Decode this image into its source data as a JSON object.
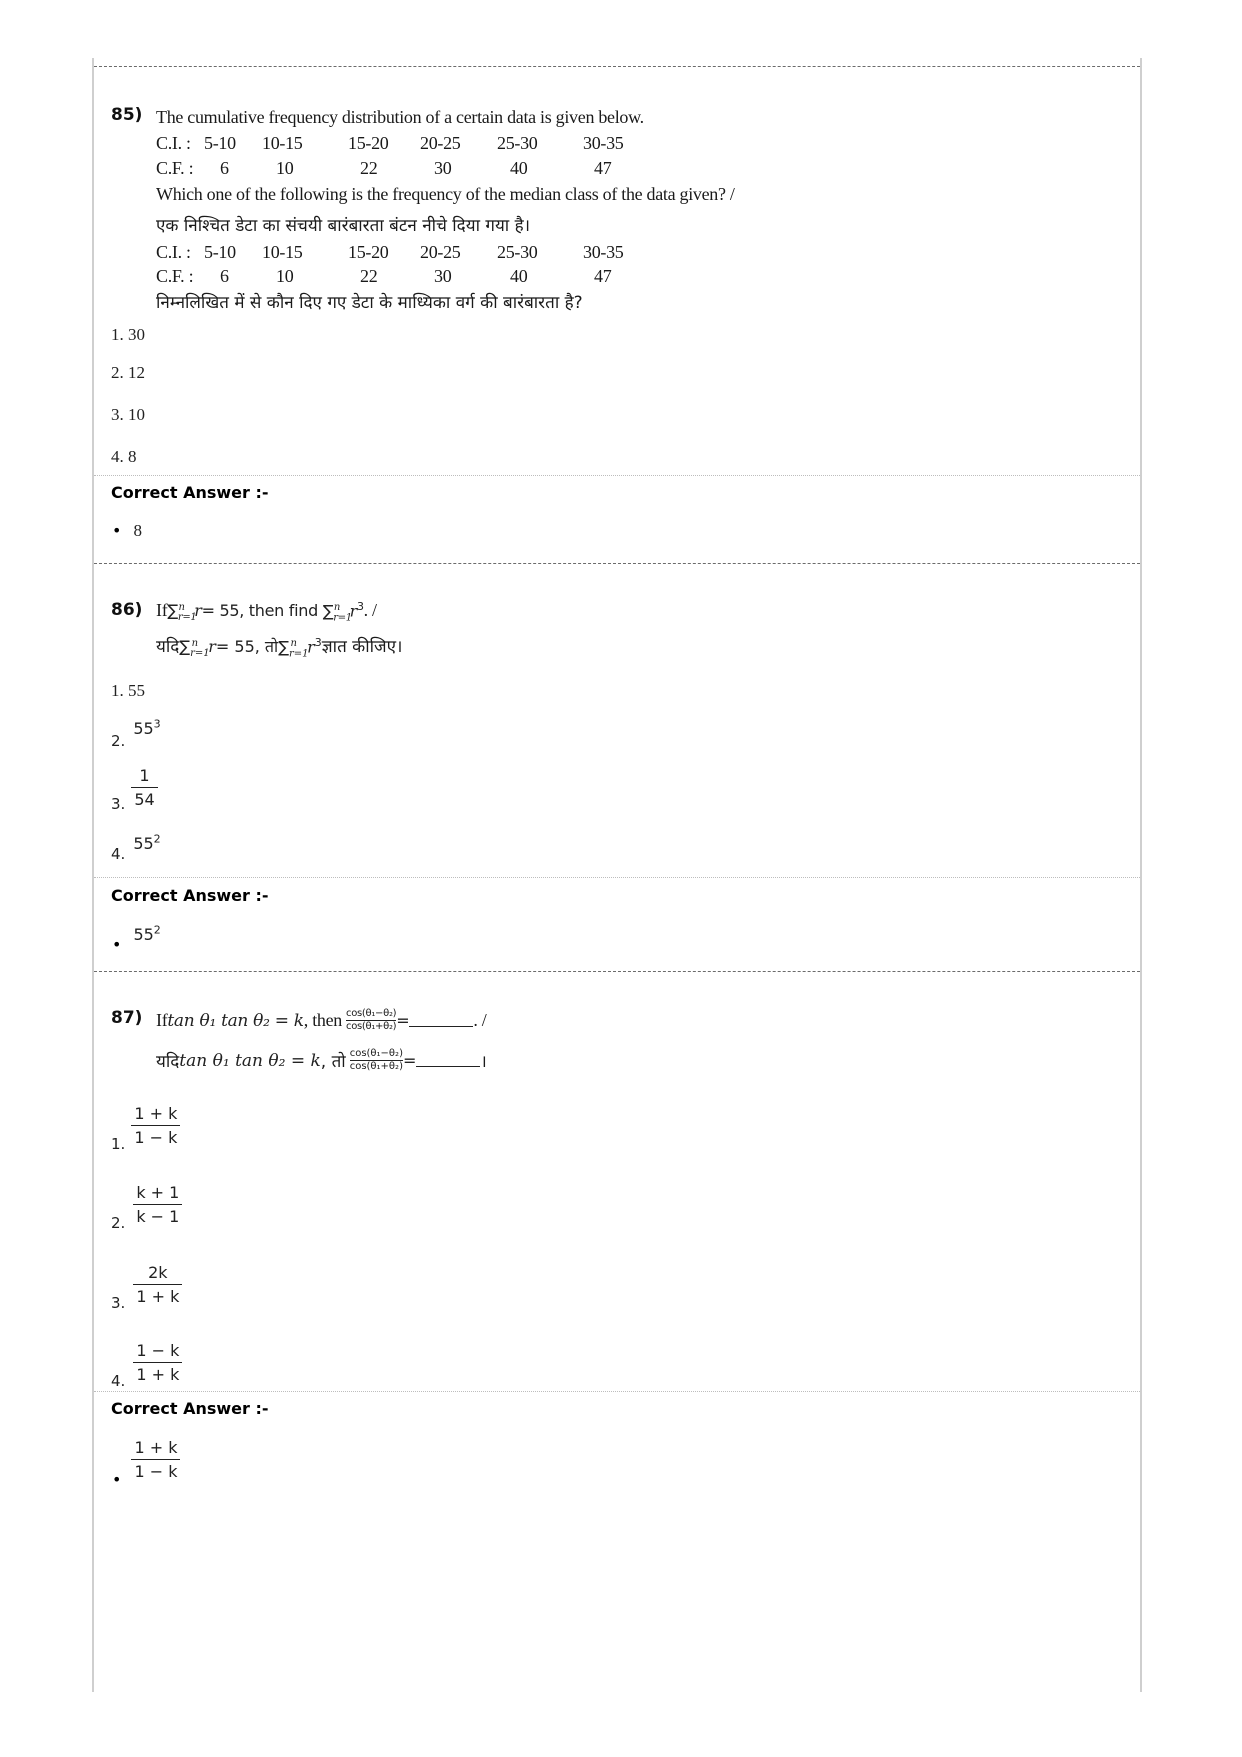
{
  "questions": [
    {
      "number": "85)",
      "english_intro": "The cumulative frequency distribution of a certain data is given below.",
      "table": {
        "ci_label": "C.I. :",
        "cf_label": "C.F. :",
        "ci": [
          "5-10",
          "10-15",
          "15-20",
          "20-25",
          "25-30",
          "30-35"
        ],
        "cf": [
          "6",
          "10",
          "22",
          "30",
          "40",
          "47"
        ]
      },
      "english_question": "Which one of the following is the frequency of the median class of the data given?  /",
      "hindi_intro": "एक निश्चित डेटा का संचयी बारंबारता बंटन नीचे दिया गया है।",
      "hindi_question": "निम्नलिखित में से कौन दिए गए डेटा के माध्यिका वर्ग की बारंबारता है?",
      "options": [
        {
          "label": "1.",
          "text": "30"
        },
        {
          "label": "2.",
          "text": "12"
        },
        {
          "label": "3.",
          "text": "10"
        },
        {
          "label": "4.",
          "text": "8"
        }
      ],
      "correct_answer_label": "Correct Answer :-",
      "correct_answer": "8"
    },
    {
      "number": "86)",
      "english": {
        "prefix": "If ",
        "sum1": "∑",
        "sub": "r=1",
        "sup": "n",
        "var": "r",
        "eq": " = 55, then find ",
        "var2": "r",
        "pow": "3",
        "suffix": "  . /"
      },
      "hindi": {
        "prefix": "यदि ",
        "eq": " = 55,  तो ",
        "suffix": " ज्ञात कीजिए।"
      },
      "options": [
        {
          "label": "1.",
          "text": "55"
        },
        {
          "label": "2.",
          "base": "55",
          "exp": "3"
        },
        {
          "label": "3.",
          "num": "1",
          "den": "54"
        },
        {
          "label": "4.",
          "base": "55",
          "exp": "2"
        }
      ],
      "correct_answer_label": "Correct Answer :-",
      "correct_answer": {
        "base": "55",
        "exp": "2"
      }
    },
    {
      "number": "87)",
      "english": {
        "prefix": "If ",
        "expr": "tan θ₁ tan θ₂ = k",
        "then": ", then",
        "frac_num": "cos(θ₁−θ₂)",
        "frac_den": "cos(θ₁+θ₂)",
        "eq": " = ",
        "suffix": ". /"
      },
      "hindi": {
        "prefix": "यदि ",
        "expr": "tan θ₁ tan θ₂ = k",
        "then": ", तो",
        "frac_num": "cos(θ₁−θ₂)",
        "frac_den": "cos(θ₁+θ₂)",
        "eq": " = ",
        "suffix": "।"
      },
      "options": [
        {
          "label": "1.",
          "num": "1 + k",
          "den": "1 − k"
        },
        {
          "label": "2.",
          "num": "k + 1",
          "den": "k − 1"
        },
        {
          "label": "3.",
          "num": "2k",
          "den": "1 + k"
        },
        {
          "label": "4.",
          "num": "1 − k",
          "den": "1 + k"
        }
      ],
      "correct_answer_label": "Correct Answer :-",
      "correct_answer": {
        "num": "1 + k",
        "den": "1 − k"
      }
    }
  ],
  "bullet": "•"
}
